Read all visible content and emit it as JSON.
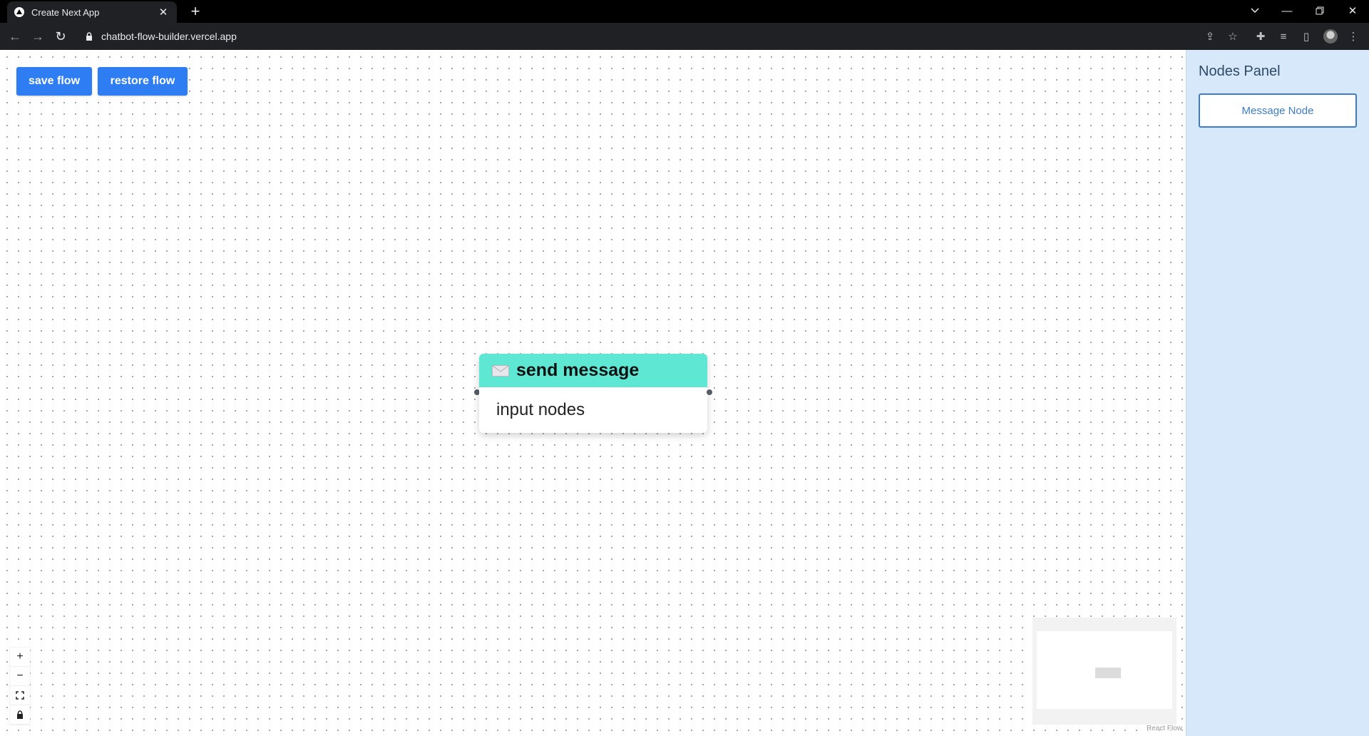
{
  "browser": {
    "tab_title": "Create Next App",
    "url": "chatbot-flow-builder.vercel.app"
  },
  "toolbar": {
    "save_label": "save flow",
    "restore_label": "restore flow"
  },
  "node": {
    "title": "send message",
    "body": "input nodes",
    "header_color": "#5ee8d3"
  },
  "controls": {
    "zoom_in": "+",
    "zoom_out": "−"
  },
  "attribution": "React Flow",
  "panel": {
    "title": "Nodes Panel",
    "message_node_label": "Message Node"
  },
  "colors": {
    "primary_button": "#2f7df2",
    "panel_background": "#d7e8fb",
    "panel_accent": "#3d7cc9"
  }
}
